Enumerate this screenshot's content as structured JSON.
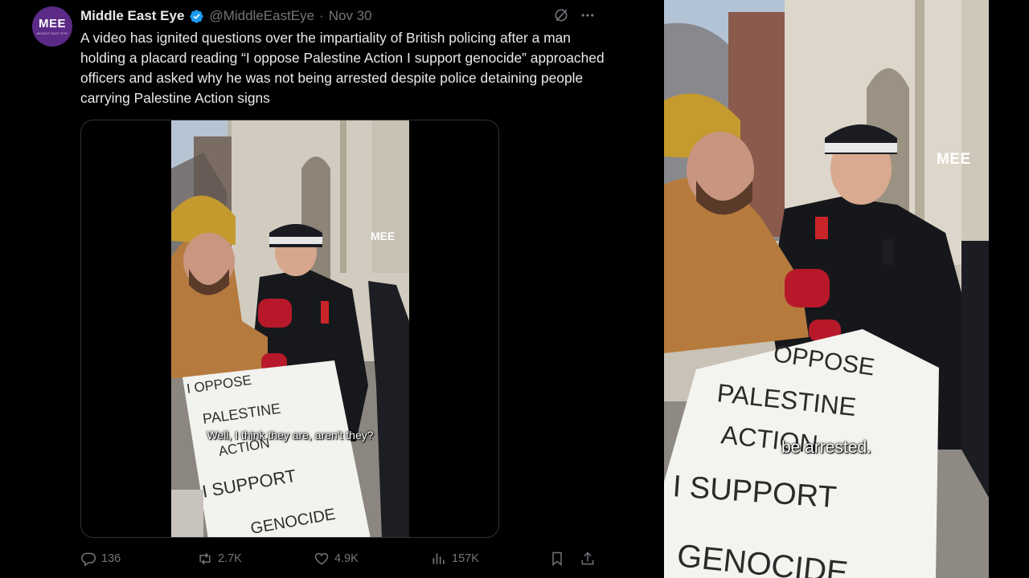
{
  "tweet": {
    "author_name": "Middle East Eye",
    "handle": "@MiddleEastEye",
    "separator": "·",
    "date": "Nov 30",
    "avatar_mark": "MEE",
    "avatar_sub": "MIDDLE EAST EYE",
    "text": "A video has ignited questions over the impartiality of British policing after a man holding a placard reading “I oppose Palestine Action I support genocide” approached officers and asked why he was not being arrested despite police detaining people carrying Palestine Action signs",
    "video_caption": "Well, I think they are, aren't they?",
    "video_watermark": "MEE",
    "placard_lines": [
      "I OPPOSE",
      "PALESTINE",
      "ACTION",
      "I SUPPORT",
      "GENOCIDE"
    ],
    "actions": {
      "replies": "136",
      "reposts": "2.7K",
      "likes": "4.9K",
      "views": "157K"
    }
  },
  "right_video": {
    "caption": "be arrested.",
    "watermark": "MEE",
    "placard_lines": [
      "OPPOSE",
      "PALESTINE",
      "ACTION",
      "I SUPPORT",
      "GENOCIDE"
    ]
  },
  "colors": {
    "background": "#000000",
    "text_primary": "#e7e9ea",
    "text_secondary": "#71767b",
    "verified_blue": "#1d9bf0",
    "avatar_purple": "#5b2a86",
    "border": "#2f3336"
  },
  "icons": [
    "verified-badge-icon",
    "grok-icon",
    "more-icon",
    "reply-icon",
    "repost-icon",
    "like-icon",
    "views-icon",
    "bookmark-icon",
    "share-icon"
  ]
}
